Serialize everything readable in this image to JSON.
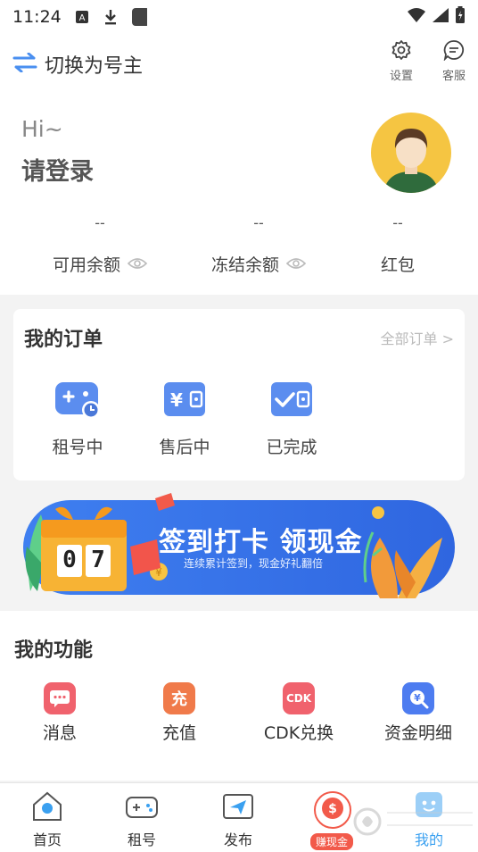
{
  "status_bar": {
    "time": "11:24"
  },
  "topbar": {
    "switch_label": "切换为号主",
    "settings_label": "设置",
    "service_label": "客服"
  },
  "profile": {
    "greeting": "Hi~",
    "login_prompt": "请登录",
    "balances": [
      {
        "value": "--",
        "label": "可用余额"
      },
      {
        "value": "--",
        "label": "冻结余额"
      },
      {
        "value": "--",
        "label": "红包"
      }
    ]
  },
  "orders": {
    "title": "我的订单",
    "all_link": "全部订单 >",
    "items": [
      {
        "label": "租号中"
      },
      {
        "label": "售后中"
      },
      {
        "label": "已完成"
      }
    ]
  },
  "banner": {
    "title": "签到打卡 领现金",
    "subtitle": "连续累计签到，现金好礼翻倍",
    "counter": [
      "0",
      "7"
    ]
  },
  "functions": {
    "title": "我的功能",
    "items": [
      {
        "label": "消息"
      },
      {
        "label": "充值",
        "glyph": "充"
      },
      {
        "label": "CDK兑换",
        "glyph": "CDK"
      },
      {
        "label": "资金明细"
      }
    ]
  },
  "tabbar": {
    "items": [
      {
        "label": "首页"
      },
      {
        "label": "租号"
      },
      {
        "label": "发布"
      },
      {
        "label": "赚现金"
      },
      {
        "label": "我的"
      }
    ]
  },
  "colors": {
    "accent": "#3aa0f0",
    "order_icon": "#5b8def",
    "message": "#f0626d",
    "recharge": "#f07a4a",
    "cdk": "#f0626d",
    "funds": "#4d7cf0",
    "banner_bg": "#3f7ff0"
  }
}
